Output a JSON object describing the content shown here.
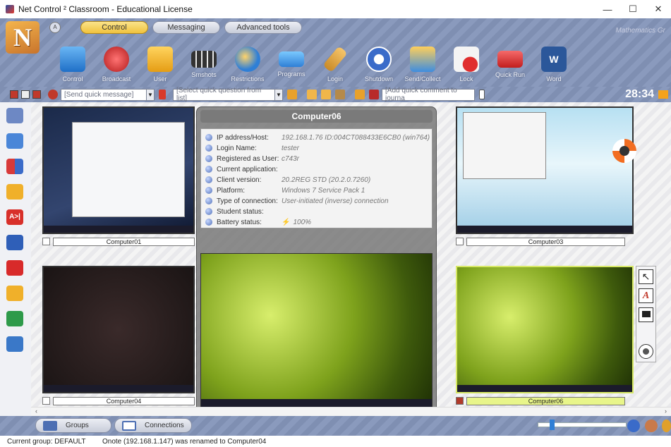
{
  "window": {
    "title": "Net Control ² Classroom - Educational License",
    "minimize": "—",
    "maximize": "☐",
    "close": "✕"
  },
  "ribbon": {
    "logo_letter": "N",
    "tab_circle": "A",
    "tabs": [
      "Control",
      "Messaging",
      "Advanced tools"
    ],
    "active_tab": "Control",
    "watermark": "Mathematics Gr",
    "tools": [
      {
        "label": "Control",
        "icon": "monitor-icon"
      },
      {
        "label": "Broadcast",
        "icon": "broadcast-icon"
      },
      {
        "label": "User",
        "icon": "user-icon"
      },
      {
        "label": "Srnshots",
        "icon": "filmstrip-icon"
      },
      {
        "label": "Restrictions",
        "icon": "internet-explorer-icon"
      },
      {
        "label": "Programs",
        "icon": "programs-icon"
      },
      {
        "label": "Login",
        "icon": "key-icon"
      },
      {
        "label": "Shutdown",
        "icon": "power-icon"
      },
      {
        "label": "Send/Collect",
        "icon": "send-collect-icon"
      },
      {
        "label": "Lock",
        "icon": "mouse-lock-icon"
      },
      {
        "label": "Quick Run",
        "icon": "quick-run-icon"
      },
      {
        "label": "Word",
        "icon": "word-icon"
      }
    ]
  },
  "quickbar": {
    "message_placeholder": "[Send quick message]",
    "question_placeholder": "[Select quick question from list]",
    "comment_placeholder": "[Add quick comment to journa",
    "timer": "28:34"
  },
  "computers": {
    "c1": "Computer01",
    "c3": "Computer03",
    "c4": "Computer04",
    "c6": "Computer06"
  },
  "popup": {
    "title": "Computer06",
    "rows": [
      {
        "key": "IP address/Host:",
        "value": "192.168.1.76 ID:004CT088433E6CB0 (win764)"
      },
      {
        "key": "Login Name:",
        "value": "tester"
      },
      {
        "key": "Registered as User:",
        "value": "c743r"
      },
      {
        "key": "Current application:",
        "value": ""
      },
      {
        "key": "Client version:",
        "value": "20.2REG STD  (20.2.0.7260)"
      },
      {
        "key": "Platform:",
        "value": "Windows 7 Service Pack 1"
      },
      {
        "key": "Type of connection:",
        "value": "User-initiated (inverse) connection"
      },
      {
        "key": "Student status:",
        "value": ""
      },
      {
        "key": "Battery status:",
        "value": "100%"
      }
    ]
  },
  "right_panel": {
    "tools": [
      "cursor-arrow-icon",
      "text-annotate-icon",
      "black-screen-icon",
      "record-icon"
    ]
  },
  "bottom": {
    "groups_tab": "Groups",
    "connections_tab": "Connections"
  },
  "status": {
    "group": "Current group: DEFAULT",
    "message": "Onote (192.168.1.147) was renamed to Computer04"
  },
  "colors": {
    "ribbon_bg": "#8a9abd",
    "active_tab": "#f0c23d",
    "selected_thumb": "#e8f58a"
  }
}
